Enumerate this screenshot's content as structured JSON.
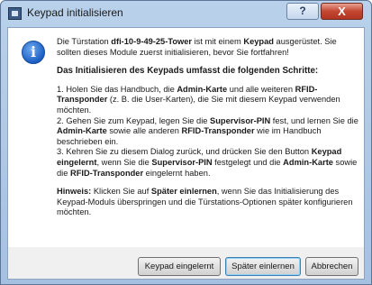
{
  "window": {
    "title": "Keypad initialisieren",
    "help_label": "?",
    "close_label": "X"
  },
  "icons": {
    "app": "keypad-app-icon",
    "info": "info-icon"
  },
  "message": {
    "intro_1": "Die Türstation ",
    "device": "dfi-10-9-49-25-Tower",
    "intro_2": " ist mit einem ",
    "keypad": "Keypad",
    "intro_3": " ausgerüstet. Sie sollten dieses Module zuerst initialisieren, bevor Sie fortfahren!",
    "heading": "Das Initialisieren des Keypads umfasst die folgenden Schritte:",
    "step1_a": "1. Holen Sie das Handbuch, die ",
    "step1_b": "Admin-Karte",
    "step1_c": " und alle weiteren ",
    "step1_d": "RFID-Transponder",
    "step1_e": " (z. B. die User-Karten), die Sie mit diesem Keypad verwenden möchten.",
    "step2_a": "2. Gehen Sie zum Keypad, legen Sie die ",
    "step2_b": "Supervisor-PIN",
    "step2_c": " fest, und lernen Sie die ",
    "step2_d": "Admin-Karte",
    "step2_e": " sowie alle anderen ",
    "step2_f": "RFID-Transponder",
    "step2_g": " wie im Handbuch beschrieben ein.",
    "step3_a": "3. Kehren Sie zu diesem Dialog zurück, und drücken Sie den Button ",
    "step3_b": "Keypad eingelernt",
    "step3_c": ", wenn Sie die ",
    "step3_d": "Supervisor-PIN",
    "step3_e": " festgelegt und die ",
    "step3_f": "Admin-Karte",
    "step3_g": " sowie die ",
    "step3_h": "RFID-Transponder",
    "step3_i": " eingelernt haben.",
    "hint_label": "Hinweis:",
    "hint_a": " Klicken Sie auf ",
    "hint_b": "Später einlernen",
    "hint_c": ", wenn Sie das Initialisierung des Keypad-Moduls überspringen und die Türstations-Optionen später konfigurieren möchten."
  },
  "buttons": {
    "keypad_done": "Keypad eingelernt",
    "later": "Später einlernen",
    "cancel": "Abbrechen"
  }
}
